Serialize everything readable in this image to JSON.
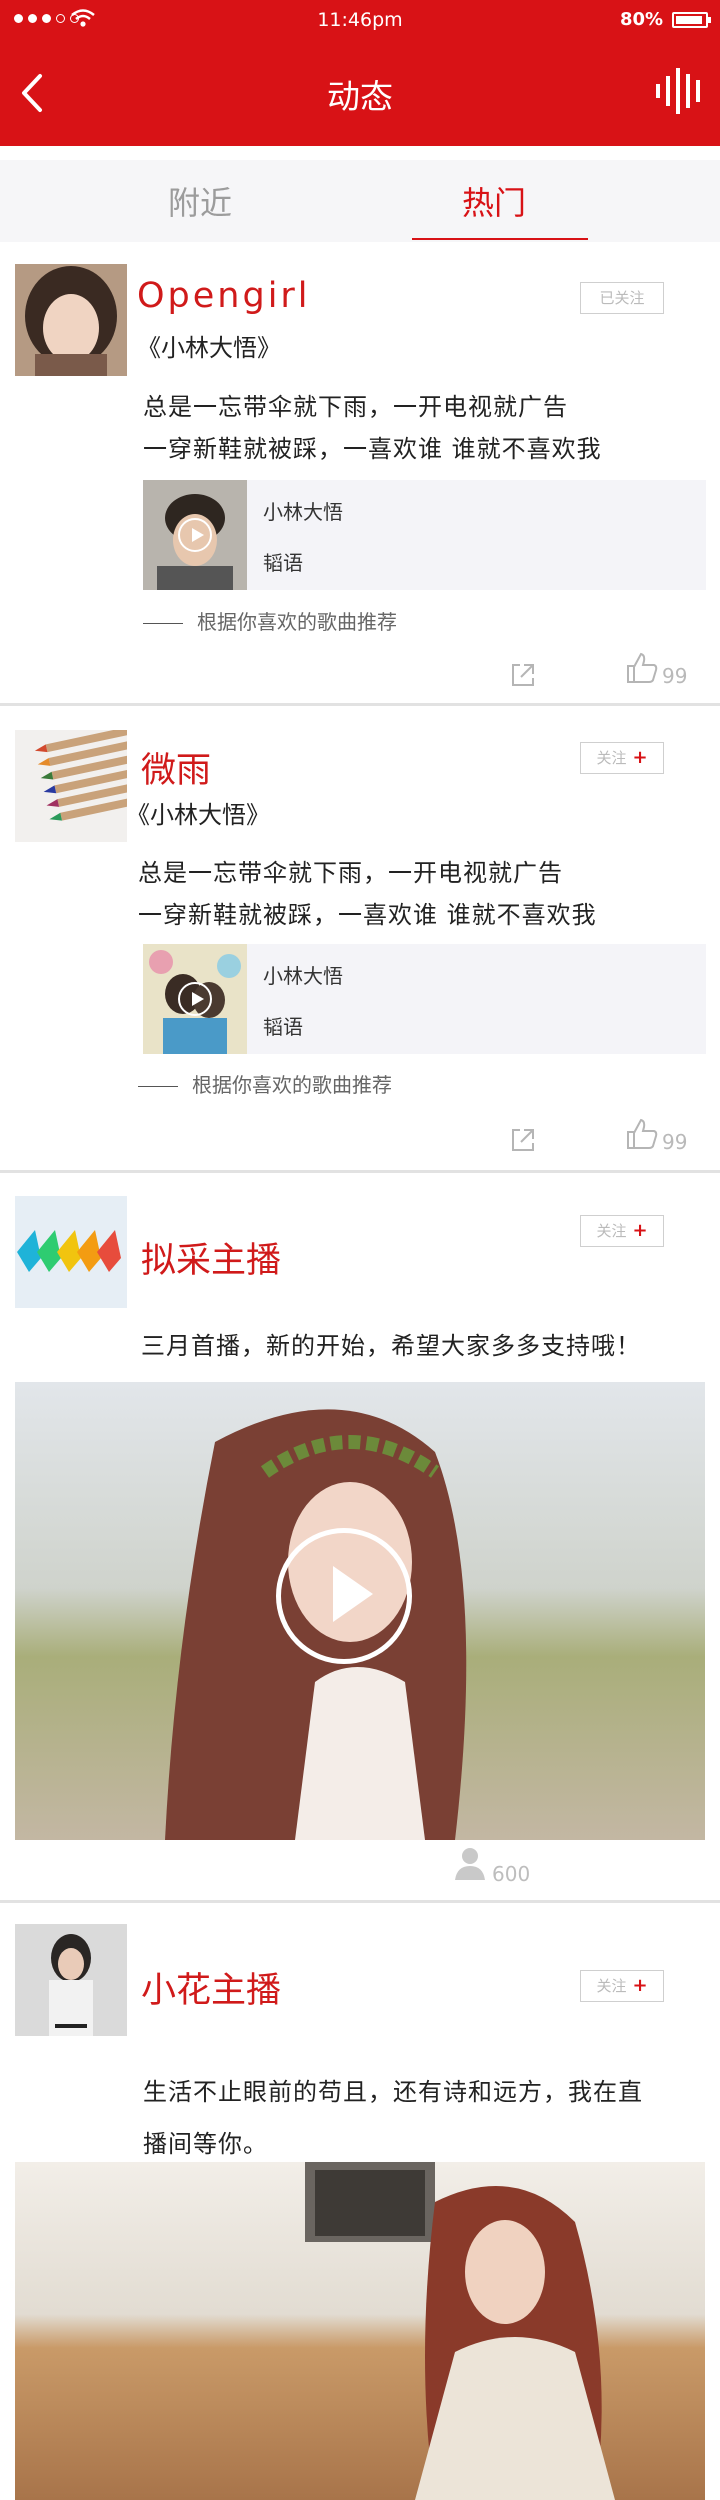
{
  "status": {
    "time": "11:46pm",
    "battery": "80%"
  },
  "nav": {
    "title": "动态"
  },
  "tabs": {
    "near": "附近",
    "hot": "热门"
  },
  "posts": [
    {
      "user": "Opengirl",
      "follow": "已关注",
      "song": "《小林大悟》",
      "lines": [
        "总是一忘带伞就下雨，一开电视就广告",
        "一穿新鞋就被踩，一喜欢谁 谁就不喜欢我"
      ],
      "card": {
        "title": "小林大悟",
        "sub": "韬语"
      },
      "rec": "根据你喜欢的歌曲推荐",
      "likes": "99"
    },
    {
      "user": "微雨",
      "follow": "关注",
      "song": "《小林大悟》",
      "lines": [
        "总是一忘带伞就下雨，一开电视就广告",
        "一穿新鞋就被踩，一喜欢谁 谁就不喜欢我"
      ],
      "card": {
        "title": "小林大悟",
        "sub": "韬语"
      },
      "rec": "根据你喜欢的歌曲推荐",
      "likes": "99"
    },
    {
      "user": "拟采主播",
      "follow": "关注",
      "lines": [
        "三月首播，新的开始，希望大家多多支持哦！"
      ],
      "viewers": "600"
    },
    {
      "user": "小花主播",
      "follow": "关注",
      "lines": [
        "生活不止眼前的苟且，还有诗和远方，我在直",
        "播间等你。"
      ]
    }
  ],
  "colors": {
    "brand": "#d81216",
    "name": "#d01a1a"
  }
}
